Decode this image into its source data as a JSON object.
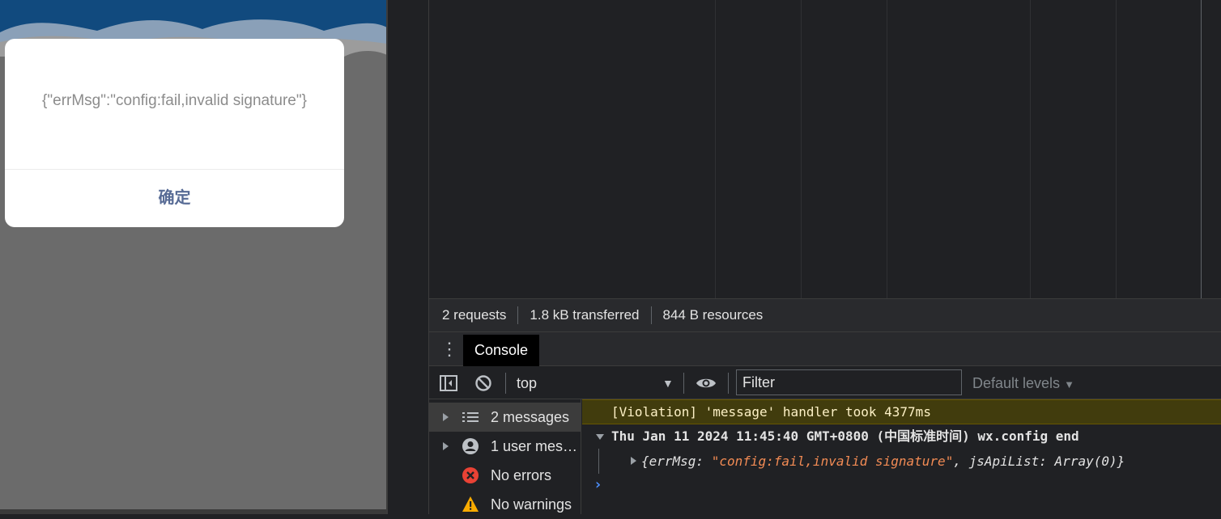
{
  "preview": {
    "dialog": {
      "message": "{\"errMsg\":\"config:fail,invalid signature\"}",
      "confirm_label": "确定"
    }
  },
  "network_summary": {
    "requests": "2 requests",
    "transferred": "1.8 kB transferred",
    "resources": "844 B resources"
  },
  "drawer": {
    "active_tab": "Console"
  },
  "console_toolbar": {
    "context": "top",
    "filter_placeholder": "Filter",
    "levels": "Default levels"
  },
  "sidebar": {
    "items": [
      {
        "label": "2 messages",
        "icon": "list-icon",
        "selected": true
      },
      {
        "label": "1 user messages",
        "icon": "user-icon",
        "selected": false
      },
      {
        "label": "No errors",
        "icon": "error-icon",
        "selected": false
      },
      {
        "label": "No warnings",
        "icon": "warning-icon",
        "selected": false
      }
    ]
  },
  "messages": {
    "violation": "[Violation] 'message' handler took 4377ms",
    "group_header": "Thu Jan 11 2024 11:45:40 GMT+0800 (中国标准时间) wx.config end",
    "object_open": "{errMsg: ",
    "object_errmsg_value": "\"config:fail,invalid signature\"",
    "object_rest": ", jsApiList: Array(0)}"
  },
  "colors": {
    "dialog_button": "#576b95",
    "violation_bg": "#413c0d",
    "string_value": "#f28b54",
    "prompt": "#4d90fe",
    "error": "#e94235",
    "warning": "#f9ab00"
  }
}
